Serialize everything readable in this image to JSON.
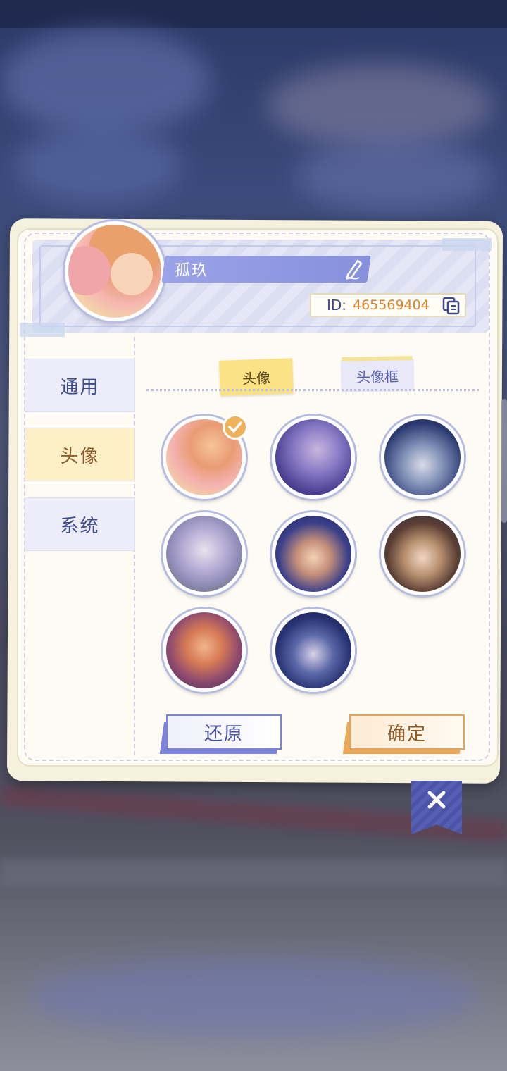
{
  "profile": {
    "name": "孤玖",
    "id_label": "ID:",
    "id_value": "465569404"
  },
  "sidebar": {
    "items": [
      {
        "label": "通用",
        "active": false
      },
      {
        "label": "头像",
        "active": true
      },
      {
        "label": "系统",
        "active": false
      }
    ]
  },
  "tabs": [
    {
      "label": "头像",
      "active": true
    },
    {
      "label": "头像框",
      "active": false
    }
  ],
  "avatars": {
    "selected_index": 0,
    "count": 8
  },
  "buttons": {
    "restore": "还原",
    "confirm": "确定"
  },
  "icons": {
    "edit": "pencil-icon",
    "copy": "copy-icon",
    "close": "close-icon",
    "selected": "check-icon"
  },
  "colors": {
    "accent_blue": "#8690dc",
    "accent_gold": "#fbe385",
    "id_orange": "#d9822e",
    "sidebar_active": "#fdf0c7"
  }
}
